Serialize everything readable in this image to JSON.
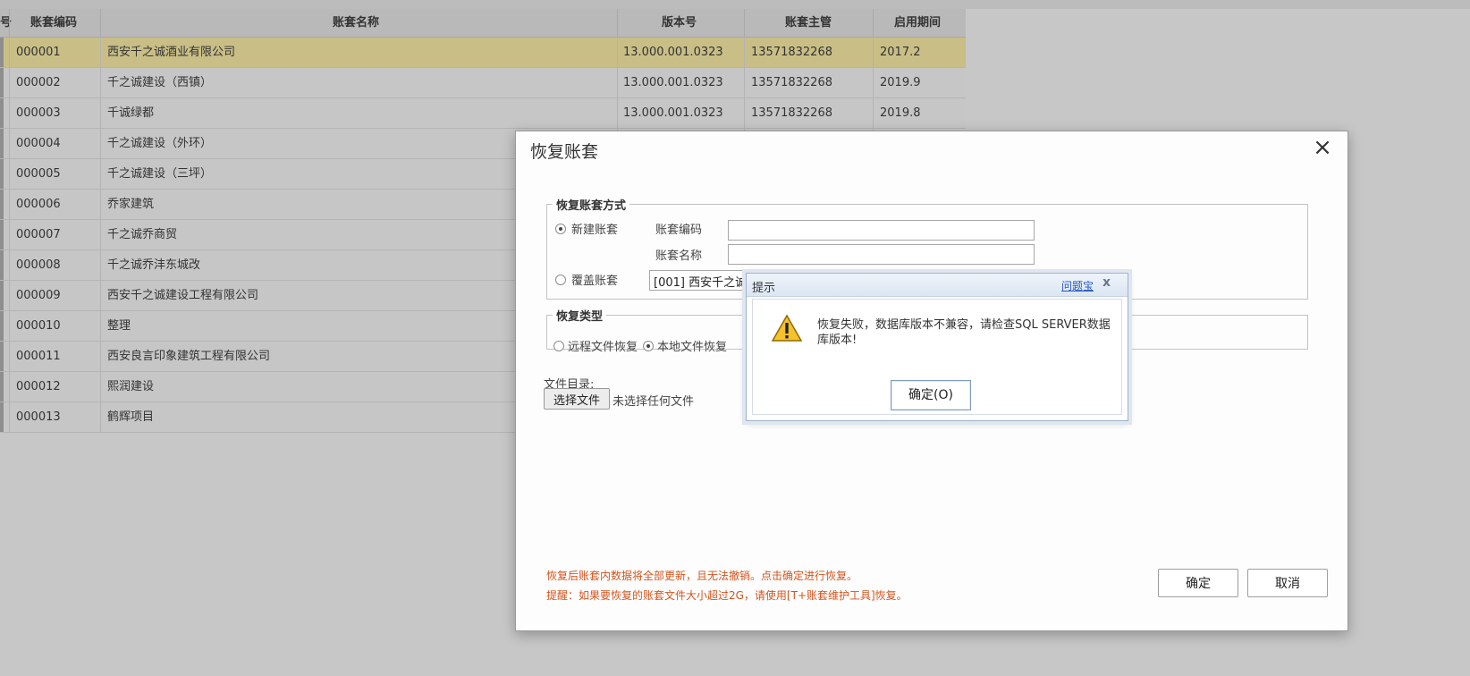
{
  "table": {
    "headers": [
      "账套编码",
      "账套名称",
      "版本号",
      "账套主管",
      "启用期间"
    ],
    "rows": [
      {
        "code": "000001",
        "name": "西安千之诚酒业有限公司",
        "version": "13.000.001.0323",
        "manager": "13571832268",
        "period": "2017.2"
      },
      {
        "code": "000002",
        "name": "千之诚建设（西镇）",
        "version": "13.000.001.0323",
        "manager": "13571832268",
        "period": "2019.9"
      },
      {
        "code": "000003",
        "name": "千诚绿都",
        "version": "13.000.001.0323",
        "manager": "13571832268",
        "period": "2019.8"
      },
      {
        "code": "000004",
        "name": "千之诚建设（外环）",
        "version": "",
        "manager": "",
        "period": ""
      },
      {
        "code": "000005",
        "name": "千之诚建设（三坪）",
        "version": "",
        "manager": "",
        "period": ""
      },
      {
        "code": "000006",
        "name": "乔家建筑",
        "version": "",
        "manager": "",
        "period": ""
      },
      {
        "code": "000007",
        "name": "千之诚乔商贸",
        "version": "",
        "manager": "",
        "period": ""
      },
      {
        "code": "000008",
        "name": "千之诚乔沣东城改",
        "version": "",
        "manager": "",
        "period": ""
      },
      {
        "code": "000009",
        "name": "西安千之诚建设工程有限公司",
        "version": "",
        "manager": "",
        "period": ""
      },
      {
        "code": "000010",
        "name": "整理",
        "version": "",
        "manager": "",
        "period": ""
      },
      {
        "code": "000011",
        "name": "西安良言印象建筑工程有限公司",
        "version": "",
        "manager": "",
        "period": ""
      },
      {
        "code": "000012",
        "name": "熙润建设",
        "version": "",
        "manager": "",
        "period": ""
      },
      {
        "code": "000013",
        "name": "鹤辉项目",
        "version": "",
        "manager": "",
        "period": ""
      }
    ]
  },
  "dialog": {
    "title": "恢复账套",
    "method_legend": "恢复账套方式",
    "new_label": "新建账套",
    "code_label": "账套编码",
    "name_label": "账套名称",
    "code_value": "",
    "name_value": "",
    "overwrite_label": "覆盖账套",
    "overwrite_value": "[001] 西安千之诚",
    "type_legend": "恢复类型",
    "remote_label": "远程文件恢复",
    "local_label": "本地文件恢复",
    "dir_label": "文件目录:",
    "choose_file": "选择文件",
    "no_file": "未选择任何文件",
    "notice1": "恢复后账套内数据将全部更新，且无法撤销。点击确定进行恢复。",
    "notice2": "提醒：如果要恢复的账套文件大小超过2G，请使用[T+账套维护工具]恢复。",
    "ok": "确定",
    "cancel": "取消"
  },
  "alert": {
    "title": "提示",
    "link": "问题宝",
    "message": "恢复失败，数据库版本不兼容，请检查SQL SERVER数据库版本!",
    "ok": "确定(O)"
  },
  "icons": {
    "close": "close-icon",
    "warning": "warning-icon",
    "alert_close": "alert-close-icon"
  },
  "colors": {
    "selected_row": "#c9be86",
    "notice_text": "#d4551e",
    "link": "#2457c5"
  }
}
